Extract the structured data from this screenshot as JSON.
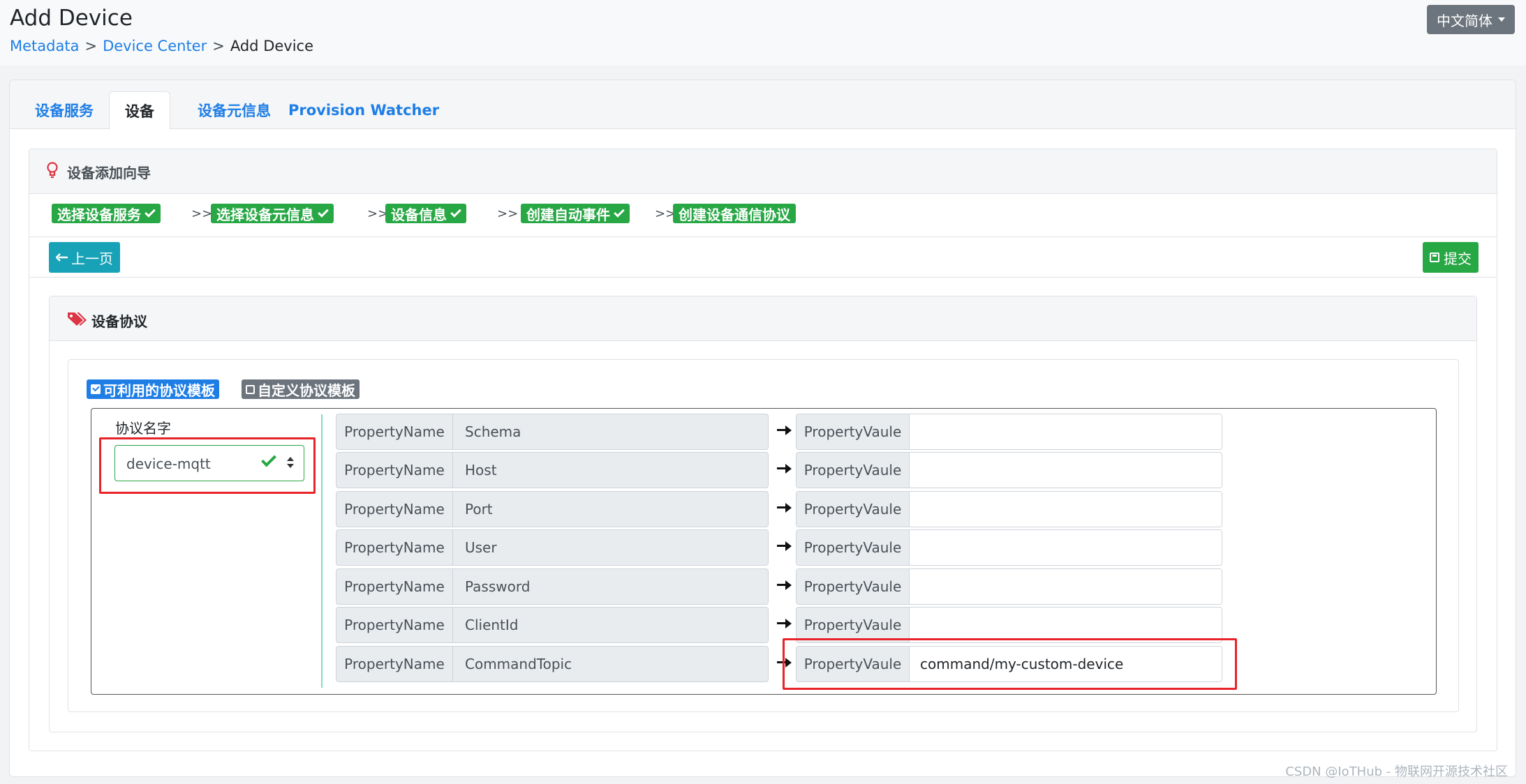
{
  "header": {
    "title": "Add Device",
    "breadcrumb": [
      "Metadata",
      "Device Center",
      "Add Device"
    ],
    "breadcrumb_sep": ">",
    "language": "中文简体"
  },
  "tabs": [
    {
      "label": "设备服务",
      "active": false
    },
    {
      "label": "设备",
      "active": true
    },
    {
      "label": "设备元信息",
      "active": false
    },
    {
      "label": "Provision Watcher",
      "active": false
    }
  ],
  "wizard": {
    "title": "设备添加向导",
    "steps": [
      {
        "label": "选择设备服务",
        "done": true
      },
      {
        "label": "选择设备元信息",
        "done": true
      },
      {
        "label": "设备信息",
        "done": true
      },
      {
        "label": "创建自动事件",
        "done": true
      },
      {
        "label": "创建设备通信协议",
        "done": false
      }
    ],
    "step_sep": ">>",
    "prev_label": "上一页",
    "submit_label": "提交"
  },
  "protocol": {
    "title": "设备协议",
    "badge_available": "可利用的协议模板",
    "badge_custom": "自定义协议模板",
    "name_label": "协议名字",
    "selected": "device-mqtt",
    "properties": [
      {
        "name_label": "PropertyName",
        "name": "Schema",
        "value_label": "PropertyVaule",
        "value": ""
      },
      {
        "name_label": "PropertyName",
        "name": "Host",
        "value_label": "PropertyVaule",
        "value": ""
      },
      {
        "name_label": "PropertyName",
        "name": "Port",
        "value_label": "PropertyVaule",
        "value": ""
      },
      {
        "name_label": "PropertyName",
        "name": "User",
        "value_label": "PropertyVaule",
        "value": ""
      },
      {
        "name_label": "PropertyName",
        "name": "Password",
        "value_label": "PropertyVaule",
        "value": ""
      },
      {
        "name_label": "PropertyName",
        "name": "ClientId",
        "value_label": "PropertyVaule",
        "value": ""
      },
      {
        "name_label": "PropertyName",
        "name": "CommandTopic",
        "value_label": "PropertyVaule",
        "value": "command/my-custom-device"
      }
    ]
  },
  "colors": {
    "primary": "#1e7ee6",
    "success": "#28a745",
    "info": "#17a2b8",
    "secondary": "#6c757d",
    "highlight": "#e8232a"
  },
  "watermark": "CSDN @IoTHub - 物联网开源技术社区"
}
